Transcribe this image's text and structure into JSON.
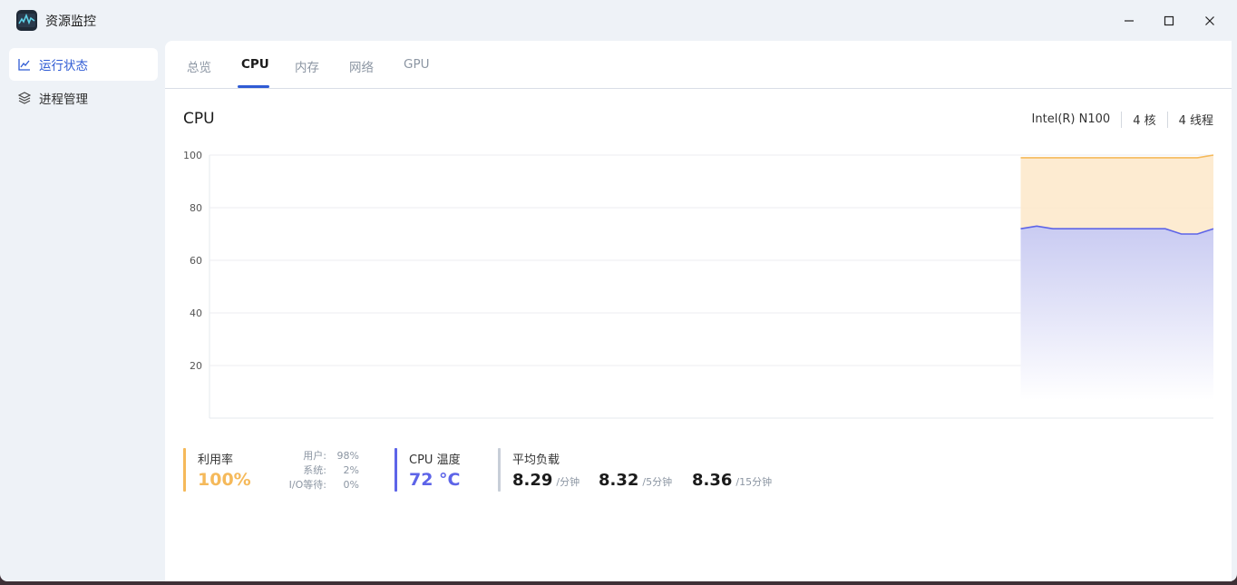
{
  "app": {
    "title": "资源监控"
  },
  "sidebar": {
    "items": [
      {
        "label": "运行状态",
        "icon": "chart-line-icon",
        "active": true
      },
      {
        "label": "进程管理",
        "icon": "layers-icon",
        "active": false
      }
    ]
  },
  "tabs": [
    {
      "label": "总览",
      "active": false
    },
    {
      "label": "CPU",
      "active": true
    },
    {
      "label": "内存",
      "active": false
    },
    {
      "label": "网络",
      "active": false
    },
    {
      "label": "GPU",
      "active": false
    }
  ],
  "cpu": {
    "title": "CPU",
    "model": "Intel(R) N100",
    "cores": "4 核",
    "threads": "4 线程"
  },
  "chart_data": {
    "type": "area",
    "y_ticks": [
      "100",
      "80",
      "60",
      "40",
      "20"
    ],
    "ylim": [
      0,
      100
    ],
    "grid": true,
    "series": [
      {
        "values": [
          99,
          99,
          99,
          99,
          99,
          99,
          99,
          99,
          99,
          99,
          99,
          99,
          100
        ],
        "color": "#f5b95a"
      },
      {
        "values": [
          72,
          73,
          72,
          72,
          72,
          72,
          72,
          72,
          72,
          72,
          70,
          70,
          72
        ],
        "color": "#5d64e8"
      }
    ],
    "visible_fraction_start": 0.808
  },
  "stats": {
    "usage": {
      "label": "利用率",
      "value": "100%",
      "color": "#f5b95a",
      "details": [
        {
          "key": "用户:",
          "value": "98%"
        },
        {
          "key": "系统:",
          "value": "2%"
        },
        {
          "key": "I/O等待:",
          "value": "0%"
        }
      ]
    },
    "temp": {
      "label": "CPU 温度",
      "value": "72 °C",
      "color": "#5d64e8"
    },
    "load": {
      "label": "平均负载",
      "values": [
        {
          "num": "8.29",
          "unit": "/分钟"
        },
        {
          "num": "8.32",
          "unit": "/5分钟"
        },
        {
          "num": "8.36",
          "unit": "/15分钟"
        }
      ]
    }
  }
}
